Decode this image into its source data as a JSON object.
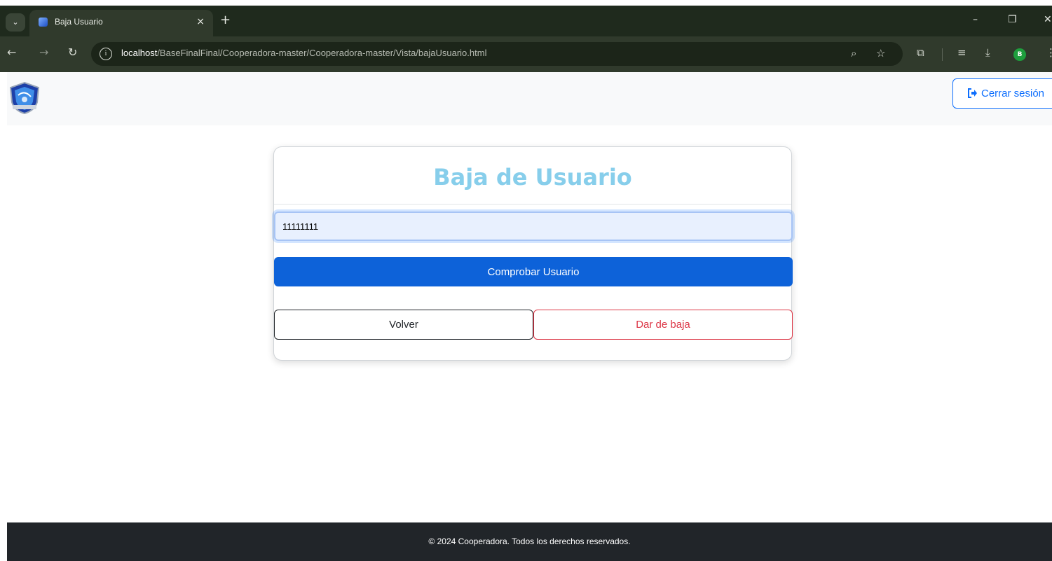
{
  "browser": {
    "tab_title": "Baja Usuario",
    "tab_close": "×",
    "new_tab": "+",
    "url_host": "localhost",
    "url_path": "/BaseFinalFinal/Cooperadora-master/Cooperadora-master/Vista/bajaUsuario.html",
    "profile_initial": "B",
    "icons": [
      "tab-search-icon",
      "back-icon",
      "forward-icon",
      "reload-icon",
      "site-info-icon",
      "zoom-icon",
      "bookmark-star-icon",
      "extensions-icon",
      "reading-list-icon",
      "download-icon",
      "menu-icon",
      "minimize-icon",
      "restore-icon",
      "close-icon"
    ]
  },
  "header": {
    "logout_label": "Cerrar sesión"
  },
  "card": {
    "title": "Baja de Usuario",
    "input_value": "11111111",
    "check_button": "Comprobar Usuario",
    "back_button": "Volver",
    "delete_button": "Dar de baja"
  },
  "footer": {
    "text": "© 2024 Cooperadora. Todos los derechos reservados."
  },
  "colors": {
    "title": "#87ceeb",
    "primary": "#0d62d9",
    "danger": "#dc3545",
    "footer_bg": "#212529",
    "header_bg": "#f8f9fa"
  }
}
